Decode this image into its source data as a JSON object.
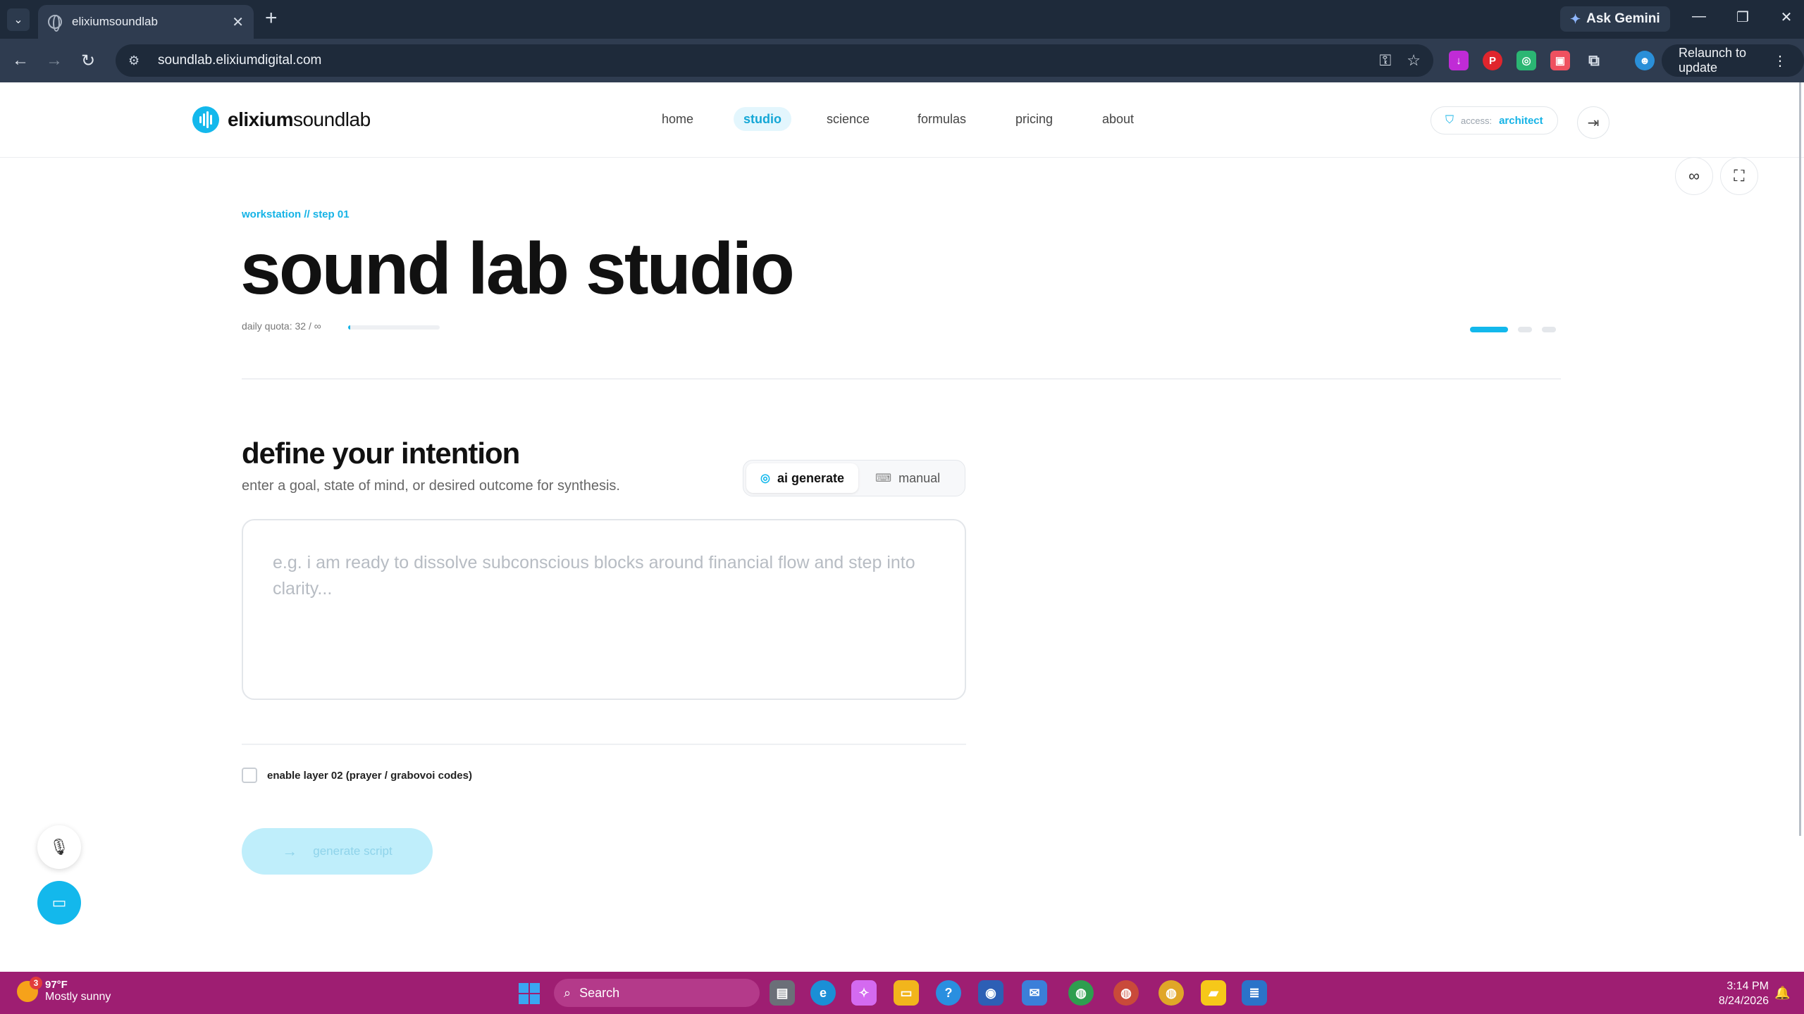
{
  "browser": {
    "tab_title": "elixiumsoundlab",
    "url": "soundlab.elixiumdigital.com",
    "ask_gemini_label": "Ask Gemini",
    "relaunch_label": "Relaunch to update"
  },
  "site": {
    "logo_bold": "elixium",
    "logo_light": "soundlab",
    "nav": [
      {
        "label": "home",
        "active": false
      },
      {
        "label": "studio",
        "active": true
      },
      {
        "label": "science",
        "active": false
      },
      {
        "label": "formulas",
        "active": false
      },
      {
        "label": "pricing",
        "active": false
      },
      {
        "label": "about",
        "active": false
      }
    ],
    "access_label": "access:",
    "access_role": "architect"
  },
  "studio": {
    "eyebrow": "workstation // step 01",
    "title": "sound lab studio",
    "quota_text": "daily quota: 32 / ∞",
    "quota_fraction": 0.02,
    "step_count": 3,
    "active_step": 1,
    "section_title": "define your intention",
    "section_subtitle": "enter a goal, state of mind, or desired outcome for synthesis.",
    "modes": [
      {
        "label": "ai generate",
        "active": true
      },
      {
        "label": "manual",
        "active": false
      }
    ],
    "intention_value": "",
    "intention_placeholder": "e.g. i am ready to dissolve subconscious blocks around financial flow and step into clarity...",
    "layer_checkbox_label": "enable layer 02 (prayer / grabovoi codes)",
    "layer_checked": false,
    "generate_label": "generate script"
  },
  "colors": {
    "accent": "#13b8ec",
    "taskbar": "#9e1e72",
    "chrome_dark": "#1e2a3a"
  },
  "taskbar": {
    "weather_badge": "3",
    "temperature": "97°F",
    "weather_desc": "Mostly sunny",
    "search_label": "Search",
    "time": "3:14 PM",
    "date": "8/24/2026"
  }
}
